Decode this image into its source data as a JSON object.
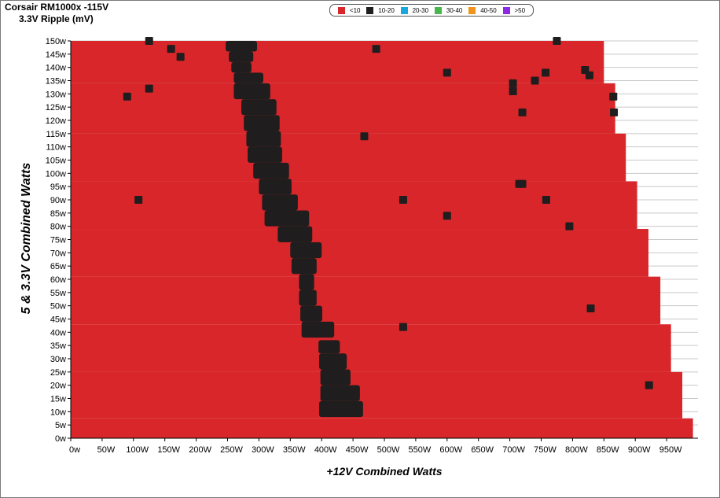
{
  "header": {
    "title": "Corsair RM1000x -115V",
    "subtitle": "3.3V Ripple (mV)"
  },
  "legend": [
    {
      "label": "<10",
      "color": "#d8262a"
    },
    {
      "label": "10-20",
      "color": "#1f1d1d"
    },
    {
      "label": "20-30",
      "color": "#1aa6df"
    },
    {
      "label": "30-40",
      "color": "#49b54d"
    },
    {
      "label": "40-50",
      "color": "#f0941d"
    },
    {
      "label": ">50",
      "color": "#8a2be2"
    }
  ],
  "chart_data": {
    "type": "heatmap",
    "title": "3.3V Ripple (mV)",
    "xlabel": "+12V Combined Watts",
    "ylabel": "5 & 3.3V Combined Watts",
    "x_ticks": [
      "0w",
      "50W",
      "100W",
      "150W",
      "200W",
      "250W",
      "300W",
      "350W",
      "400W",
      "450W",
      "500W",
      "550W",
      "600W",
      "650W",
      "700W",
      "750W",
      "800W",
      "850W",
      "900W",
      "950W"
    ],
    "y_ticks": [
      "0w",
      "5w",
      "10w",
      "15w",
      "20w",
      "25w",
      "30w",
      "35w",
      "40w",
      "45w",
      "50w",
      "55w",
      "60w",
      "65w",
      "70w",
      "75w",
      "80w",
      "85w",
      "90w",
      "95w",
      "100w",
      "105w",
      "110w",
      "115w",
      "120w",
      "125w",
      "130w",
      "135w",
      "140w",
      "145w",
      "150w"
    ],
    "xlim": [
      0,
      1000
    ],
    "ylim": [
      0,
      150
    ],
    "grid": true,
    "legend_position": "top",
    "background_category": "<10",
    "max_12v_by_minor_load": [
      {
        "y_from": 0,
        "y_to": 7.5,
        "x_max": 992
      },
      {
        "y_from": 7.5,
        "y_to": 25,
        "x_max": 975
      },
      {
        "y_from": 25,
        "y_to": 43,
        "x_max": 957
      },
      {
        "y_from": 43,
        "y_to": 61,
        "x_max": 940
      },
      {
        "y_from": 61,
        "y_to": 79,
        "x_max": 921
      },
      {
        "y_from": 79,
        "y_to": 97,
        "x_max": 903
      },
      {
        "y_from": 97,
        "y_to": 115,
        "x_max": 885
      },
      {
        "y_from": 115,
        "y_to": 134,
        "x_max": 868
      },
      {
        "y_from": 134,
        "y_to": 150,
        "x_max": 850
      }
    ],
    "band_10_20": [
      {
        "y": [
          146,
          150
        ],
        "x": [
          247,
          297
        ]
      },
      {
        "y": [
          142,
          146
        ],
        "x": [
          252,
          291
        ]
      },
      {
        "y": [
          138,
          142
        ],
        "x": [
          256,
          288
        ]
      },
      {
        "y": [
          134,
          138
        ],
        "x": [
          260,
          307
        ]
      },
      {
        "y": [
          128,
          134
        ],
        "x": [
          260,
          318
        ]
      },
      {
        "y": [
          122,
          128
        ],
        "x": [
          272,
          328
        ]
      },
      {
        "y": [
          116,
          122
        ],
        "x": [
          276,
          333
        ]
      },
      {
        "y": [
          110,
          116
        ],
        "x": [
          280,
          335
        ]
      },
      {
        "y": [
          104,
          110
        ],
        "x": [
          282,
          337
        ]
      },
      {
        "y": [
          98,
          104
        ],
        "x": [
          291,
          348
        ]
      },
      {
        "y": [
          92,
          98
        ],
        "x": [
          300,
          352
        ]
      },
      {
        "y": [
          86,
          92
        ],
        "x": [
          305,
          362
        ]
      },
      {
        "y": [
          80,
          86
        ],
        "x": [
          309,
          380
        ]
      },
      {
        "y": [
          74,
          80
        ],
        "x": [
          330,
          385
        ]
      },
      {
        "y": [
          68,
          74
        ],
        "x": [
          350,
          400
        ]
      },
      {
        "y": [
          62,
          68
        ],
        "x": [
          352,
          392
        ]
      },
      {
        "y": [
          56,
          62
        ],
        "x": [
          364,
          388
        ]
      },
      {
        "y": [
          50,
          56
        ],
        "x": [
          364,
          392
        ]
      },
      {
        "y": [
          44,
          50
        ],
        "x": [
          366,
          401
        ]
      },
      {
        "y": [
          38,
          44
        ],
        "x": [
          368,
          420
        ]
      },
      {
        "y": [
          32,
          37
        ],
        "x": [
          395,
          429
        ]
      },
      {
        "y": [
          26,
          32
        ],
        "x": [
          396,
          440
        ]
      },
      {
        "y": [
          20,
          26
        ],
        "x": [
          398,
          446
        ]
      },
      {
        "y": [
          14,
          20
        ],
        "x": [
          398,
          461
        ]
      },
      {
        "y": [
          8,
          14
        ],
        "x": [
          396,
          466
        ]
      }
    ],
    "spots_10_20": [
      {
        "x": 125,
        "y": 150
      },
      {
        "x": 160,
        "y": 147
      },
      {
        "x": 175,
        "y": 144
      },
      {
        "x": 487,
        "y": 147
      },
      {
        "x": 775,
        "y": 150
      },
      {
        "x": 600,
        "y": 138
      },
      {
        "x": 757,
        "y": 138
      },
      {
        "x": 820,
        "y": 139
      },
      {
        "x": 827,
        "y": 137
      },
      {
        "x": 740,
        "y": 135
      },
      {
        "x": 705,
        "y": 134
      },
      {
        "x": 705,
        "y": 131
      },
      {
        "x": 125,
        "y": 132
      },
      {
        "x": 90,
        "y": 129
      },
      {
        "x": 865,
        "y": 129
      },
      {
        "x": 720,
        "y": 123
      },
      {
        "x": 866,
        "y": 123
      },
      {
        "x": 468,
        "y": 114
      },
      {
        "x": 720,
        "y": 96
      },
      {
        "x": 715,
        "y": 96
      },
      {
        "x": 758,
        "y": 90
      },
      {
        "x": 530,
        "y": 90
      },
      {
        "x": 108,
        "y": 90
      },
      {
        "x": 600,
        "y": 84
      },
      {
        "x": 795,
        "y": 80
      },
      {
        "x": 829,
        "y": 49
      },
      {
        "x": 530,
        "y": 42
      },
      {
        "x": 922,
        "y": 20
      }
    ]
  }
}
